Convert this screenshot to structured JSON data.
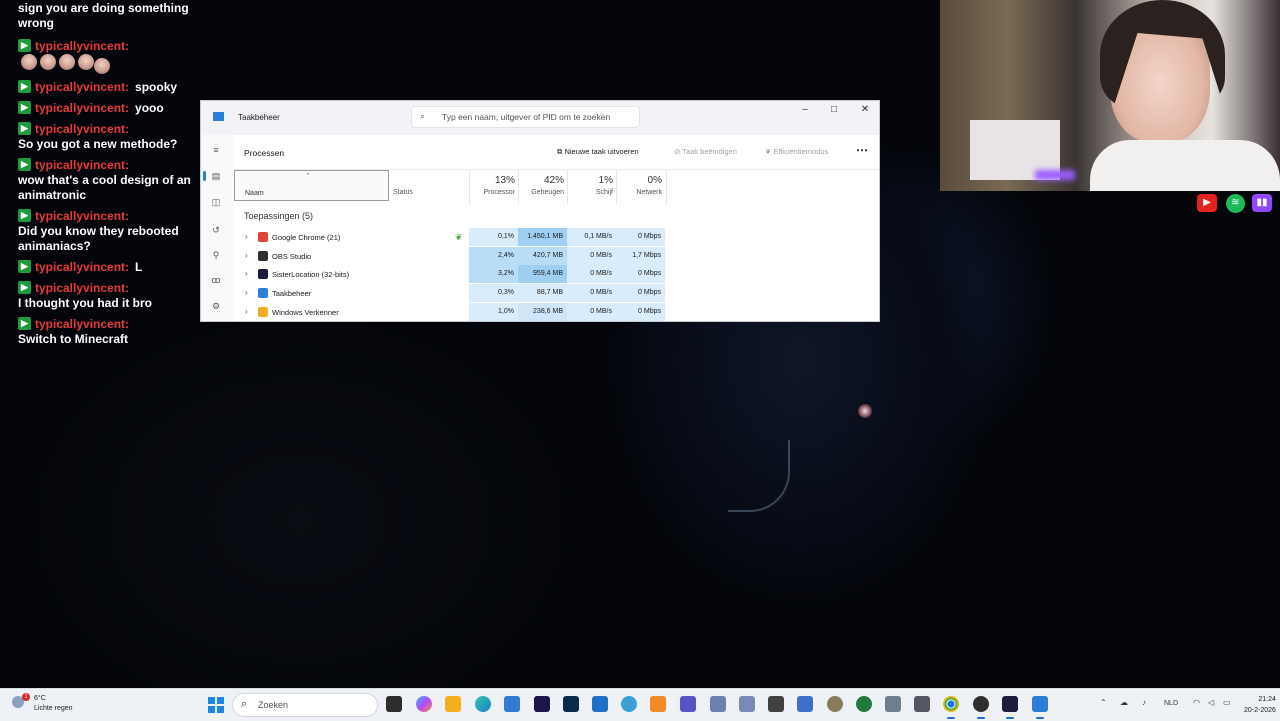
{
  "chat": {
    "prev_text": "sign you are doing something wrong",
    "messages": [
      {
        "user": "typicallyvincent:",
        "text": "",
        "emotes": 5
      },
      {
        "user": "typicallyvincent:",
        "text": "spooky"
      },
      {
        "user": "typicallyvincent:",
        "text": "yooo"
      },
      {
        "user": "typicallyvincent:",
        "text": "So you got a new methode?"
      },
      {
        "user": "typicallyvincent:",
        "text": "wow that's a cool design of an animatronic"
      },
      {
        "user": "typicallyvincent:",
        "text": "Did you know they rebooted animaniacs?"
      },
      {
        "user": "typicallyvincent:",
        "text": "L"
      },
      {
        "user": "typicallyvincent:",
        "text": "I thought you had it bro"
      },
      {
        "user": "typicallyvincent:",
        "text": "Switch to Minecraft"
      }
    ],
    "badge_color": "#1f9b3e",
    "username_color": "#e63a3a"
  },
  "taskmanager": {
    "title": "Taakbeheer",
    "search_placeholder": "Typ een naam, uitgever of PID om te zoeken",
    "page_title": "Processen",
    "actions": {
      "new_task": "Nieuwe taak uitvoeren",
      "end_task": "Taak beëindigen",
      "efficiency": "Efficiëntiemodus",
      "more": "⋯"
    },
    "columns": {
      "name": "Naam",
      "status": "Status",
      "cpu_pct": "13%",
      "cpu": "Processor",
      "mem_pct": "42%",
      "mem": "Geheugen",
      "disk_pct": "1%",
      "disk": "Schijf",
      "net_pct": "0%",
      "net": "Netwerk"
    },
    "group": "Toepassingen (5)",
    "rows": [
      {
        "name": "Google Chrome (21)",
        "cpu": "0,1%",
        "mem": "1.450,1 MB",
        "disk": "0,1 MB/s",
        "net": "0 Mbps",
        "icon_color": "#db4437"
      },
      {
        "name": "OBS Studio",
        "cpu": "2,4%",
        "mem": "420,7 MB",
        "disk": "0 MB/s",
        "net": "1,7 Mbps",
        "icon_color": "#303030"
      },
      {
        "name": "SisterLocation (32-bits)",
        "cpu": "3,2%",
        "mem": "959,4 MB",
        "disk": "0 MB/s",
        "net": "0 Mbps",
        "icon_color": "#1b1d3a"
      },
      {
        "name": "Taakbeheer",
        "cpu": "0,3%",
        "mem": "88,7 MB",
        "disk": "0 MB/s",
        "net": "0 Mbps",
        "icon_color": "#2b7fd8"
      },
      {
        "name": "Windows Verkenner",
        "cpu": "1,0%",
        "mem": "238,6 MB",
        "disk": "0 MB/s",
        "net": "0 Mbps",
        "icon_color": "#f2b01e"
      }
    ]
  },
  "taskbar": {
    "weather_temp": "6°C",
    "weather_cond": "Lichte regen",
    "weather_badge": "1",
    "search_placeholder": "Zoeken",
    "lang": "NLD",
    "time": "21:24",
    "date": "20-2-2026"
  }
}
